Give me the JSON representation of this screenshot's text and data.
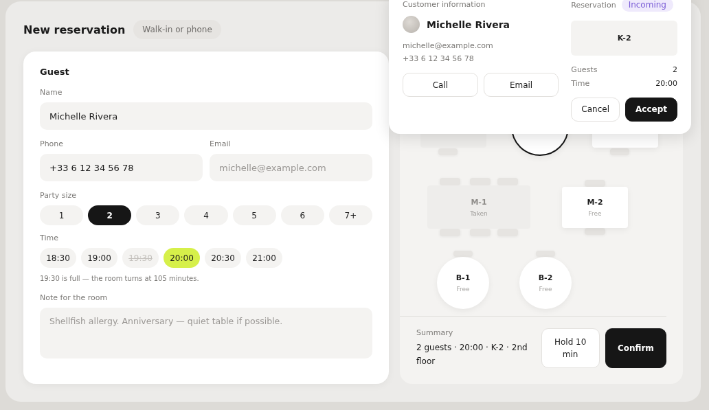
{
  "header": {
    "title": "New reservation",
    "badge": "Walk-in or phone"
  },
  "guest": {
    "title": "Guest",
    "name": {
      "label": "Name",
      "value": "Michelle Rivera"
    },
    "phone": {
      "label": "Phone",
      "value": "+33 6 12 34 56 78"
    },
    "email": {
      "label": "Email",
      "placeholder": "michelle@example.com"
    },
    "party_size": {
      "label": "Party size",
      "options": [
        {
          "label": "1",
          "selected": false
        },
        {
          "label": "2",
          "selected": true
        },
        {
          "label": "3",
          "selected": false
        },
        {
          "label": "4",
          "selected": false
        },
        {
          "label": "5",
          "selected": false
        },
        {
          "label": "6",
          "selected": false
        },
        {
          "label": "7+",
          "selected": false
        }
      ]
    },
    "time": {
      "label": "Time",
      "options": [
        {
          "label": "18:30",
          "selected": false,
          "disabled": false
        },
        {
          "label": "19:00",
          "selected": false,
          "disabled": false
        },
        {
          "label": "19:30",
          "selected": false,
          "disabled": true
        },
        {
          "label": "20:00",
          "selected": true,
          "disabled": false
        },
        {
          "label": "20:30",
          "selected": false,
          "disabled": false
        },
        {
          "label": "21:00",
          "selected": false,
          "disabled": false
        }
      ],
      "hint": "19:30 is full — the room turns at 105 minutes."
    },
    "note": {
      "label": "Note for the room",
      "placeholder": "Shellfish allergy. Anniversary — quiet table if possible."
    }
  },
  "floor": {
    "tables": [
      {
        "kind": "rect",
        "taken": true,
        "selected": false
      },
      {
        "kind": "round",
        "taken": false,
        "selected": true
      },
      {
        "kind": "rect",
        "taken": false,
        "selected": false
      },
      {
        "kind": "wide",
        "taken": true,
        "selected": false,
        "name": "M-1",
        "status": "Taken"
      },
      {
        "kind": "rect",
        "taken": false,
        "selected": false,
        "name": "M-2",
        "status": "Free"
      },
      {
        "kind": "round",
        "taken": false,
        "selected": false,
        "name": "B-1",
        "status": "Free"
      },
      {
        "kind": "round",
        "taken": false,
        "selected": false,
        "name": "B-2",
        "status": "Free"
      }
    ]
  },
  "summary": {
    "label": "Summary",
    "text": "2 guests · 20:00 · K-2 · 2nd floor",
    "buttons": [
      {
        "label": "Hold 10 min",
        "kind": "secondary"
      },
      {
        "label": "Confirm",
        "kind": "primary"
      }
    ]
  },
  "popup": {
    "customer_label": "Customer information",
    "name": "Michelle Rivera",
    "email": "michelle@example.com",
    "phone": "+33 6 12 34 56 78",
    "actions": [
      "Call",
      "Email"
    ],
    "reservation_label": "Reservation",
    "status": "Incoming",
    "table": "K-2",
    "details": [
      {
        "label": "Guests",
        "value": "2"
      },
      {
        "label": "Time",
        "value": "20:00"
      }
    ],
    "buttons": [
      {
        "label": "Cancel",
        "kind": "secondary"
      },
      {
        "label": "Accept",
        "kind": "primary"
      }
    ]
  }
}
